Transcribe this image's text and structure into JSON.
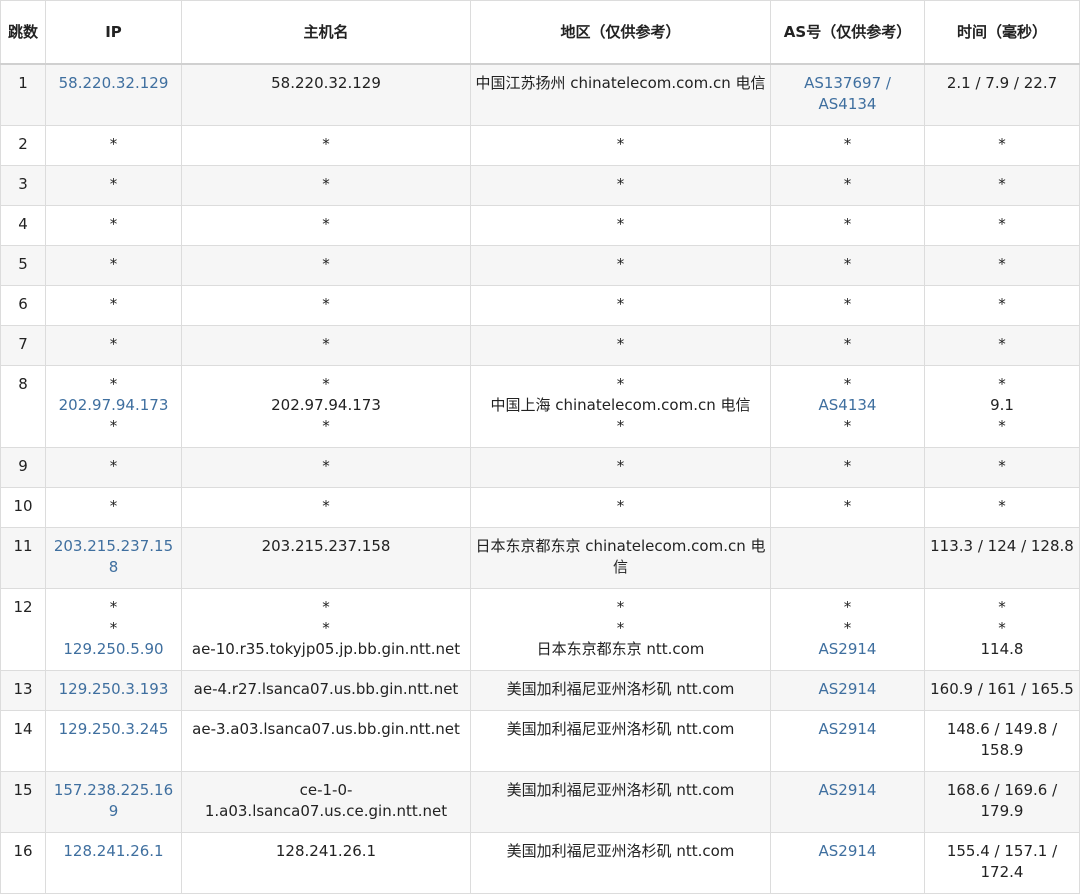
{
  "columns": {
    "hop": "跳数",
    "ip": "IP",
    "host": "主机名",
    "region": "地区（仅供参考）",
    "as": "AS号（仅供参考）",
    "time": "时间（毫秒）"
  },
  "colors": {
    "link": "#3f6f9f",
    "stripe": "#f6f6f6",
    "border": "#dcdcdc"
  },
  "rows": [
    {
      "hop": "1",
      "ip": [
        "58.220.32.129"
      ],
      "host": [
        "58.220.32.129"
      ],
      "region": [
        "中国江苏扬州 chinatelecom.com.cn 电信"
      ],
      "as": [
        "AS137697 / AS4134"
      ],
      "time": [
        "2.1 / 7.9 / 22.7"
      ]
    },
    {
      "hop": "2",
      "ip": [
        "*"
      ],
      "host": [
        "*"
      ],
      "region": [
        "*"
      ],
      "as": [
        "*"
      ],
      "time": [
        "*"
      ]
    },
    {
      "hop": "3",
      "ip": [
        "*"
      ],
      "host": [
        "*"
      ],
      "region": [
        "*"
      ],
      "as": [
        "*"
      ],
      "time": [
        "*"
      ]
    },
    {
      "hop": "4",
      "ip": [
        "*"
      ],
      "host": [
        "*"
      ],
      "region": [
        "*"
      ],
      "as": [
        "*"
      ],
      "time": [
        "*"
      ]
    },
    {
      "hop": "5",
      "ip": [
        "*"
      ],
      "host": [
        "*"
      ],
      "region": [
        "*"
      ],
      "as": [
        "*"
      ],
      "time": [
        "*"
      ]
    },
    {
      "hop": "6",
      "ip": [
        "*"
      ],
      "host": [
        "*"
      ],
      "region": [
        "*"
      ],
      "as": [
        "*"
      ],
      "time": [
        "*"
      ]
    },
    {
      "hop": "7",
      "ip": [
        "*"
      ],
      "host": [
        "*"
      ],
      "region": [
        "*"
      ],
      "as": [
        "*"
      ],
      "time": [
        "*"
      ]
    },
    {
      "hop": "8",
      "ip": [
        "*",
        "202.97.94.173",
        "*"
      ],
      "host": [
        "*",
        "202.97.94.173",
        "*"
      ],
      "region": [
        "*",
        "中国上海 chinatelecom.com.cn 电信",
        "*"
      ],
      "as": [
        "*",
        "AS4134",
        "*"
      ],
      "time": [
        "*",
        "9.1",
        "*"
      ]
    },
    {
      "hop": "9",
      "ip": [
        "*"
      ],
      "host": [
        "*"
      ],
      "region": [
        "*"
      ],
      "as": [
        "*"
      ],
      "time": [
        "*"
      ]
    },
    {
      "hop": "10",
      "ip": [
        "*"
      ],
      "host": [
        "*"
      ],
      "region": [
        "*"
      ],
      "as": [
        "*"
      ],
      "time": [
        "*"
      ]
    },
    {
      "hop": "11",
      "ip": [
        "203.215.237.158"
      ],
      "host": [
        "203.215.237.158"
      ],
      "region": [
        "日本东京都东京 chinatelecom.com.cn 电信"
      ],
      "as": [],
      "time": [
        "113.3 / 124 / 128.8"
      ]
    },
    {
      "hop": "12",
      "ip": [
        "*",
        "*",
        "129.250.5.90"
      ],
      "host": [
        "*",
        "*",
        "ae-10.r35.tokyjp05.jp.bb.gin.ntt.net"
      ],
      "region": [
        "*",
        "*",
        "日本东京都东京 ntt.com"
      ],
      "as": [
        "*",
        "*",
        "AS2914"
      ],
      "time": [
        "*",
        "*",
        "114.8"
      ]
    },
    {
      "hop": "13",
      "ip": [
        "129.250.3.193"
      ],
      "host": [
        "ae-4.r27.lsanca07.us.bb.gin.ntt.net"
      ],
      "region": [
        "美国加利福尼亚州洛杉矶 ntt.com"
      ],
      "as": [
        "AS2914"
      ],
      "time": [
        "160.9 / 161 / 165.5"
      ]
    },
    {
      "hop": "14",
      "ip": [
        "129.250.3.245"
      ],
      "host": [
        "ae-3.a03.lsanca07.us.bb.gin.ntt.net"
      ],
      "region": [
        "美国加利福尼亚州洛杉矶 ntt.com"
      ],
      "as": [
        "AS2914"
      ],
      "time": [
        "148.6 / 149.8 / 158.9"
      ]
    },
    {
      "hop": "15",
      "ip": [
        "157.238.225.169"
      ],
      "host": [
        "ce-1-0-1.a03.lsanca07.us.ce.gin.ntt.net"
      ],
      "region": [
        "美国加利福尼亚州洛杉矶 ntt.com"
      ],
      "as": [
        "AS2914"
      ],
      "time": [
        "168.6 / 169.6 / 179.9"
      ]
    },
    {
      "hop": "16",
      "ip": [
        "128.241.26.1"
      ],
      "host": [
        "128.241.26.1"
      ],
      "region": [
        "美国加利福尼亚州洛杉矶 ntt.com"
      ],
      "as": [
        "AS2914"
      ],
      "time": [
        "155.4 / 157.1 / 172.4"
      ]
    }
  ]
}
